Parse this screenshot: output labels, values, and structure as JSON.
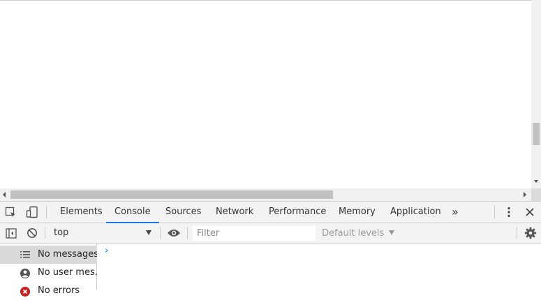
{
  "viewport": {},
  "devtools": {
    "tabs": [
      {
        "label": "Elements"
      },
      {
        "label": "Console",
        "active": true
      },
      {
        "label": "Sources"
      },
      {
        "label": "Network"
      },
      {
        "label": "Performance"
      },
      {
        "label": "Memory"
      },
      {
        "label": "Application"
      }
    ],
    "more_tabs": "»",
    "accent_color": "#1a73e8"
  },
  "console_toolbar": {
    "context": "top",
    "filter_placeholder": "Filter",
    "levels": "Default levels"
  },
  "sidebar": {
    "items": [
      {
        "label": "No messages",
        "icon": "list-icon"
      },
      {
        "label": "No user mes...",
        "icon": "user-icon"
      },
      {
        "label": "No errors",
        "icon": "error-icon"
      }
    ]
  },
  "console": {
    "prompt": "›"
  }
}
